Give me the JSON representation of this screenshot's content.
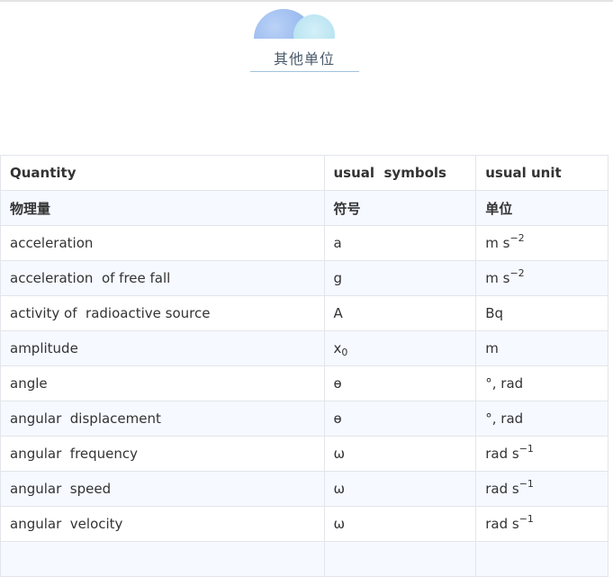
{
  "section": {
    "title": "其他单位"
  },
  "table": {
    "headers": [
      "Quantity",
      "usual  symbols",
      "usual unit"
    ],
    "subheaders": [
      "物理量",
      "符号",
      "单位"
    ],
    "rows": [
      {
        "quantity": "acceleration",
        "symbol": "a",
        "symbol_sub": "",
        "unit": "m s",
        "unit_sup": "−2"
      },
      {
        "quantity": "acceleration  of free fall",
        "symbol": "g",
        "symbol_sub": "",
        "unit": "m s",
        "unit_sup": "−2"
      },
      {
        "quantity": "activity of  radioactive source",
        "symbol": "A",
        "symbol_sub": "",
        "unit": "Bq",
        "unit_sup": ""
      },
      {
        "quantity": "amplitude",
        "symbol": "x",
        "symbol_sub": "0",
        "unit": "m",
        "unit_sup": ""
      },
      {
        "quantity": "angle",
        "symbol": "ѳ",
        "symbol_sub": "",
        "unit": "°, rad",
        "unit_sup": ""
      },
      {
        "quantity": "angular  displacement",
        "symbol": "ѳ",
        "symbol_sub": "",
        "unit": "°, rad",
        "unit_sup": ""
      },
      {
        "quantity": "angular  frequency",
        "symbol": "ω",
        "symbol_sub": "",
        "unit": "rad s",
        "unit_sup": "−1"
      },
      {
        "quantity": "angular  speed",
        "symbol": "ω",
        "symbol_sub": "",
        "unit": "rad s",
        "unit_sup": "−1"
      },
      {
        "quantity": "angular  velocity",
        "symbol": "ω",
        "symbol_sub": "",
        "unit": "rad s",
        "unit_sup": "−1"
      },
      {
        "quantity": "",
        "symbol": "",
        "symbol_sub": "",
        "unit": "",
        "unit_sup": ""
      }
    ]
  }
}
